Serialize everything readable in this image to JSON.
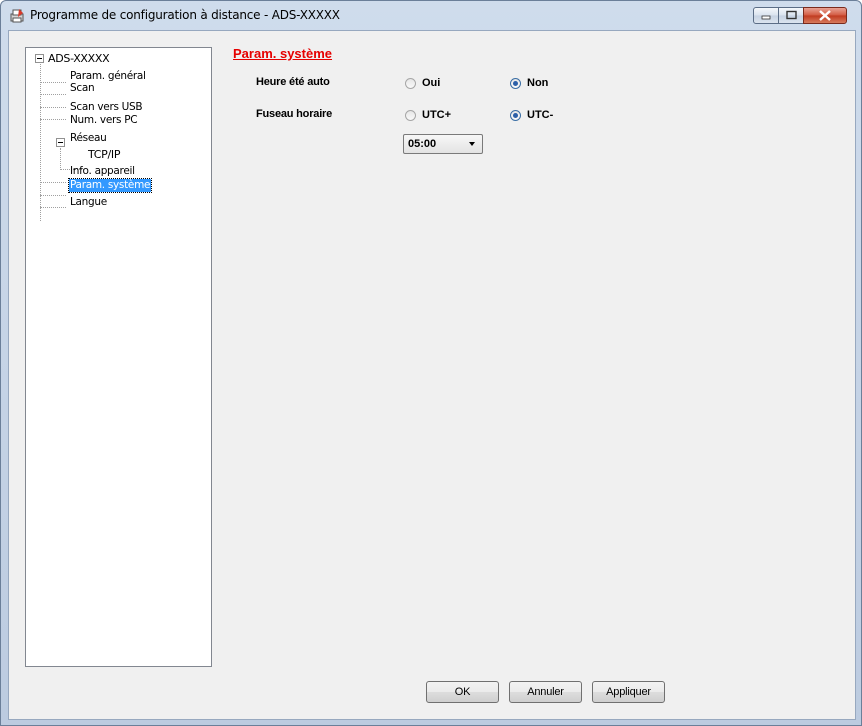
{
  "window": {
    "title": "Programme de configuration à distance - ADS-XXXXX",
    "icon": "printer-config-icon",
    "controls": [
      "minimize-icon",
      "maximize-icon",
      "close-icon"
    ]
  },
  "tree": {
    "root": "ADS-XXXXX",
    "items": {
      "param_general": "Param. général",
      "scan": "Scan",
      "scan_usb": "Scan vers USB",
      "num_pc": "Num. vers PC",
      "reseau": "Réseau",
      "tcpip": "TCP/IP",
      "info_appareil": "Info. appareil",
      "param_systeme": "Param. système",
      "langue": "Langue"
    },
    "selected": "Param. système"
  },
  "panel": {
    "title": "Param. système",
    "dst": {
      "label": "Heure été auto",
      "options": [
        "Oui",
        "Non"
      ],
      "selected": "Non"
    },
    "timezone": {
      "label": "Fuseau horaire",
      "options": [
        "UTC+",
        "UTC-"
      ],
      "selected": "UTC-",
      "offset": "05:00"
    }
  },
  "buttons": {
    "ok": "OK",
    "cancel": "Annuler",
    "apply": "Appliquer"
  },
  "colors": {
    "section_title": "#e60000",
    "selection": "#3399ff"
  }
}
